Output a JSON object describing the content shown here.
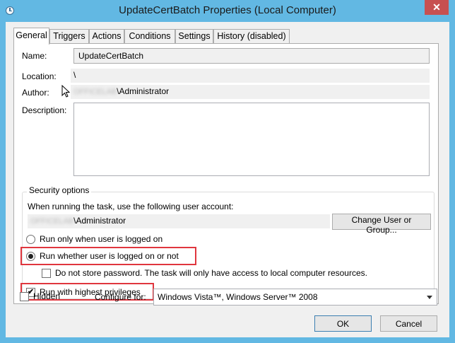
{
  "window": {
    "title": "UpdateCertBatch Properties (Local Computer)",
    "close_label": "✕"
  },
  "tabs": [
    {
      "label": "General"
    },
    {
      "label": "Triggers"
    },
    {
      "label": "Actions"
    },
    {
      "label": "Conditions"
    },
    {
      "label": "Settings"
    },
    {
      "label": "History (disabled)"
    }
  ],
  "general": {
    "name_label": "Name:",
    "name_value": "UpdateCertBatch",
    "location_label": "Location:",
    "location_value": "\\",
    "author_label": "Author:",
    "author_redacted": "OFFICELAB",
    "author_suffix": "\\Administrator",
    "description_label": "Description:",
    "description_value": ""
  },
  "security": {
    "legend": "Security options",
    "account_prompt": "When running the task, use the following user account:",
    "account_redacted": "OFFICELAB",
    "account_suffix": "\\Administrator",
    "change_user_button": "Change User or Group...",
    "radio_logged_on": "Run only when user is logged on",
    "radio_whether": "Run whether user is logged on or not",
    "selected_option": "Run whether user is logged on or not",
    "no_store_password": "Do not store password.  The task will only have access to local computer resources.",
    "no_store_password_checked": false,
    "highest_privileges": "Run with highest privileges",
    "highest_privileges_checked": true
  },
  "footer": {
    "hidden_label": "Hidden",
    "hidden_checked": false,
    "configure_label": "Configure for:",
    "configure_value": "Windows Vista™, Windows Server™ 2008",
    "ok_label": "OK",
    "cancel_label": "Cancel"
  },
  "colors": {
    "title_bar": "#62B8E3",
    "close_button": "#C75050",
    "highlight_box": "#E0363E",
    "dialog_background": "#F0F0F0"
  }
}
